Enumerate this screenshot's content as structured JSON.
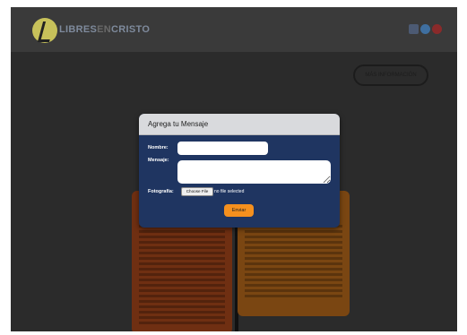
{
  "header": {
    "logo_main": "LIBRES",
    "logo_mid": "EN",
    "logo_tail": "CRISTO",
    "social_icons": [
      "facebook-icon",
      "twitter-icon",
      "pinterest-icon"
    ]
  },
  "hero": {
    "more_label": "MÁS INFORMACIÓN"
  },
  "modal": {
    "title": "Agrega tu Mensaje",
    "nombre_label": "Nombre:",
    "nombre_value": "",
    "mensaje_label": "Mensaje:",
    "mensaje_value": "",
    "foto_label": "Fotografía:",
    "file_button": "Choose File",
    "file_status": "no file selected",
    "submit_label": "Enviar"
  },
  "colors": {
    "overlay": "#2a2a2a",
    "modal_bg": "#1f3561",
    "modal_header": "#d9dadd",
    "accent_button": "#f5901e"
  }
}
